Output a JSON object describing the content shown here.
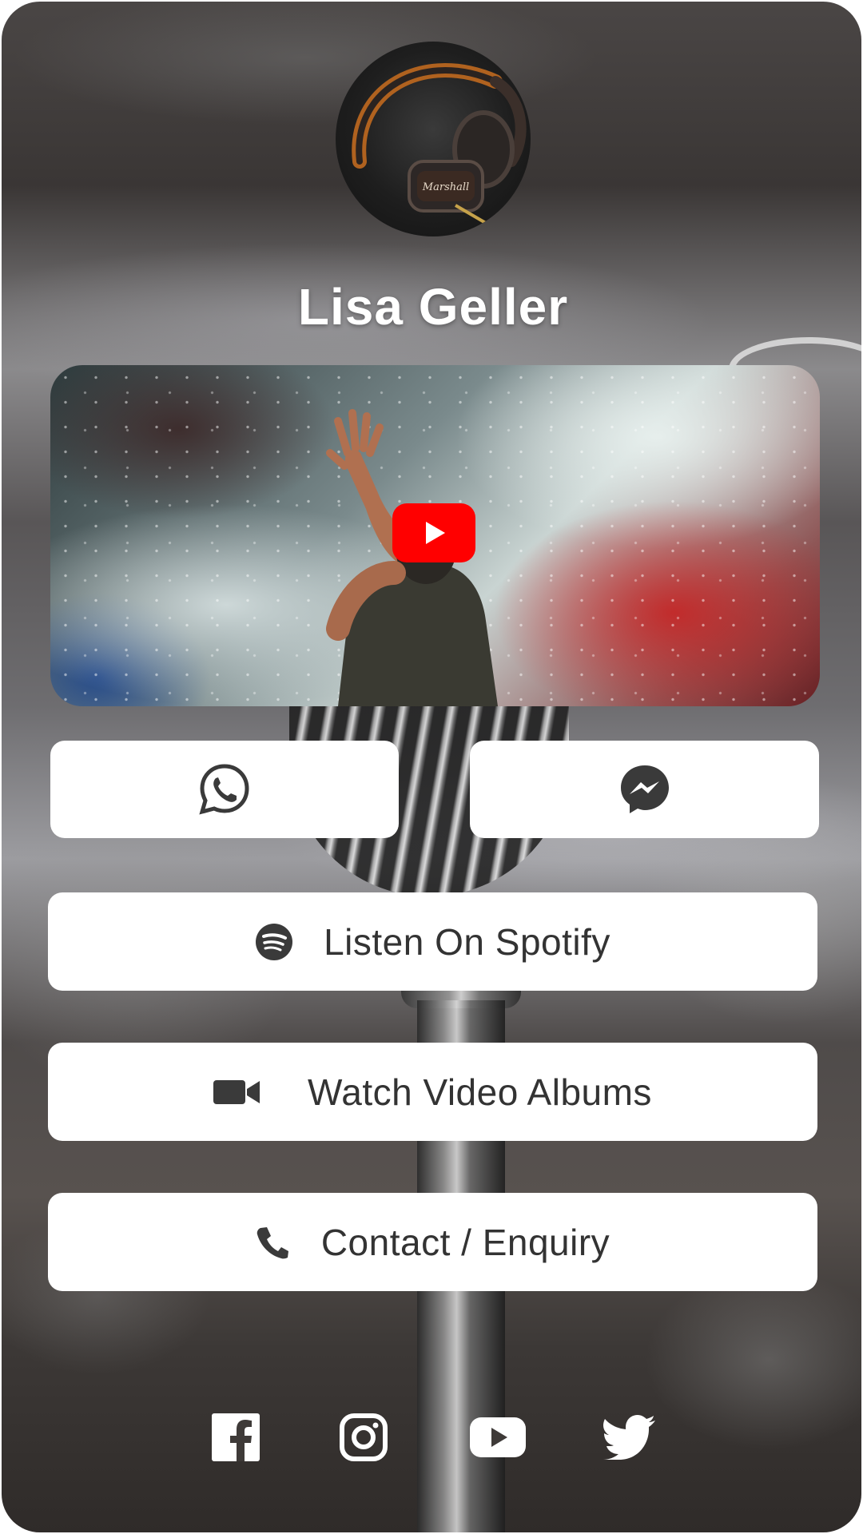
{
  "profile": {
    "name": "Lisa Geller",
    "avatar_icon": "headphones-photo"
  },
  "video": {
    "thumbnail": "concert-performer-photo",
    "play_icon": "youtube-play-icon",
    "play_color": "#ff0000"
  },
  "contact_buttons": {
    "whatsapp_icon": "whatsapp-icon",
    "messenger_icon": "messenger-icon"
  },
  "links": {
    "spotify_label": "Listen On Spotify",
    "spotify_icon": "spotify-icon",
    "video_label": "Watch Video Albums",
    "video_icon": "video-camera-icon",
    "contact_label": "Contact / Enquiry",
    "contact_icon": "phone-icon"
  },
  "socials": [
    "facebook-icon",
    "instagram-icon",
    "youtube-icon",
    "twitter-icon"
  ],
  "colors": {
    "button_bg": "#ffffff",
    "button_text": "#333333",
    "title_text": "#ffffff"
  }
}
